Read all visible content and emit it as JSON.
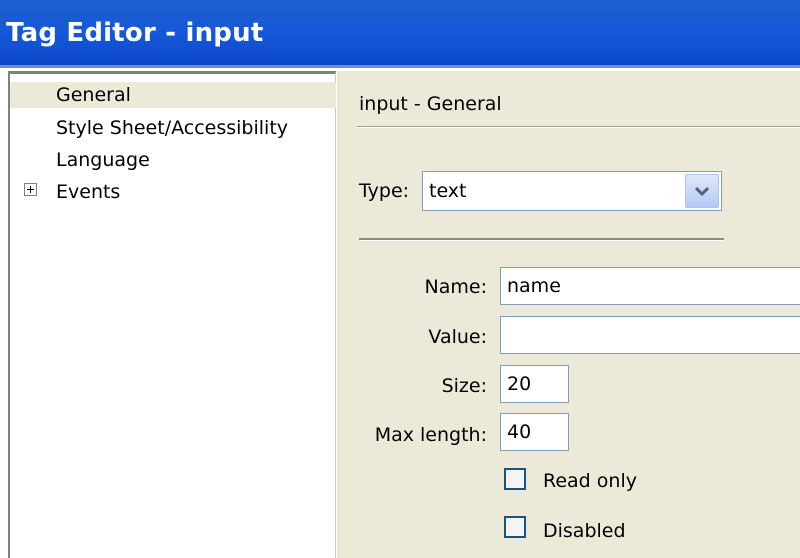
{
  "window": {
    "title": "Tag Editor - input"
  },
  "tree": {
    "items": [
      {
        "label": "General",
        "selected": true
      },
      {
        "label": "Style Sheet/Accessibility"
      },
      {
        "label": "Language"
      },
      {
        "label": "Events",
        "expandable": true
      }
    ],
    "expander_icon": "plus-box-icon"
  },
  "panel": {
    "title": "input - General",
    "type": {
      "label": "Type:",
      "value": "text",
      "dropdown_icon": "chevron-down-icon"
    },
    "name": {
      "label": "Name:",
      "value": "name"
    },
    "value": {
      "label": "Value:",
      "value": ""
    },
    "size": {
      "label": "Size:",
      "value": "20"
    },
    "maxlength": {
      "label": "Max length:",
      "value": "40"
    },
    "readonly": {
      "label": "Read only",
      "checked": false
    },
    "disabled": {
      "label": "Disabled",
      "checked": false
    }
  },
  "colors": {
    "titlebar": "#1557d8",
    "panel_bg": "#ece9d8",
    "field_border": "#7f9db9"
  }
}
